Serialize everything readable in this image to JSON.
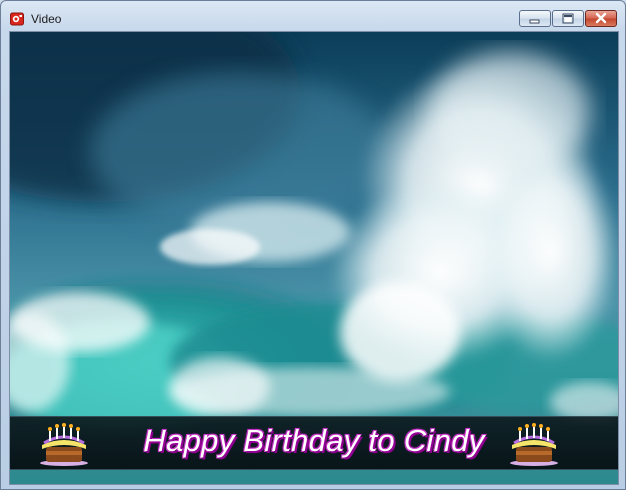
{
  "window": {
    "title": "Video"
  },
  "titlebar": {
    "app_icon": "video-app-icon",
    "minimize_icon": "minimize-icon",
    "maximize_icon": "maximize-icon",
    "close_icon": "close-icon"
  },
  "video": {
    "scene": "ocean-wave",
    "banner_text": "Happy Birthday to Cindy",
    "left_decoration": "birthday-cake-icon",
    "right_decoration": "birthday-cake-icon"
  },
  "colors": {
    "banner_text_glow": "#b000b0",
    "banner_background": "#0c181c",
    "close_button": "#c2452d"
  }
}
